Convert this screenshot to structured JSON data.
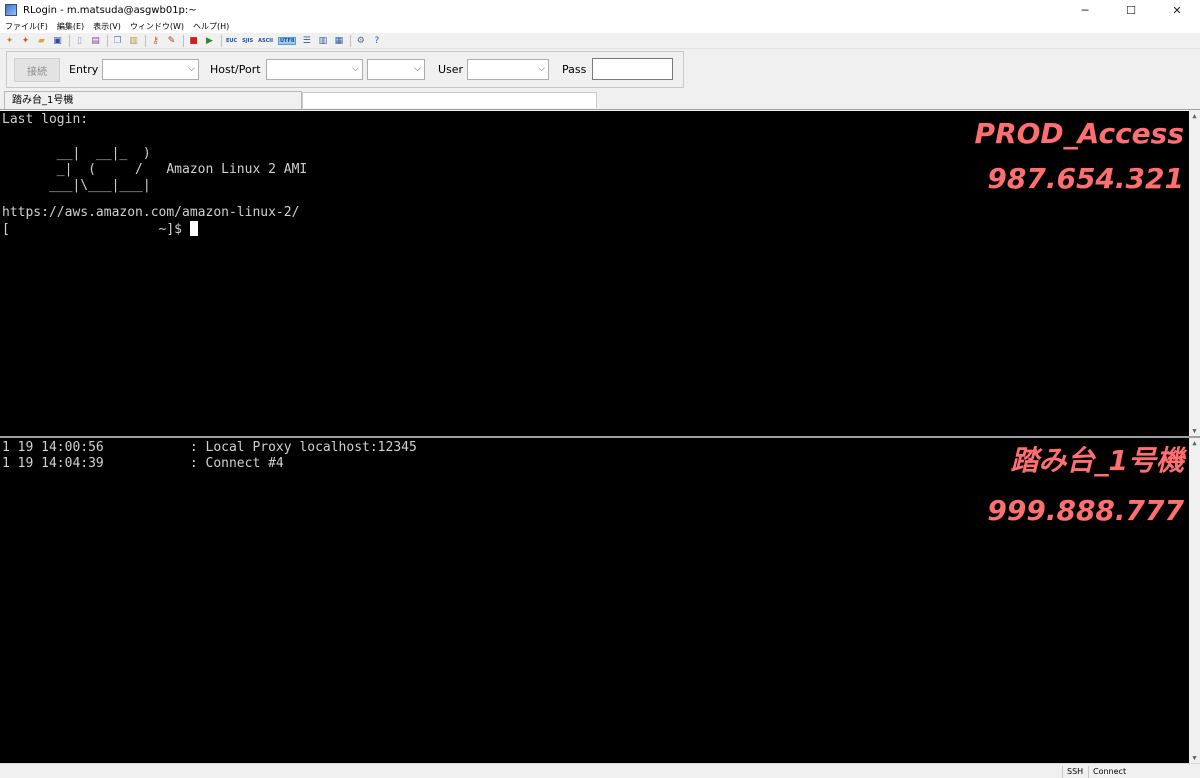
{
  "window": {
    "title": "RLogin - m.matsuda@asgwb01p:~",
    "minimize": "─",
    "maximize": "☐",
    "close": "✕"
  },
  "menu": [
    "ファイル(F)",
    "編集(E)",
    "表示(V)",
    "ウィンドウ(W)",
    "ヘルプ(H)"
  ],
  "toolbar": {
    "icons": [
      "new-connection-icon",
      "connect-icon",
      "open-icon",
      "save-icon",
      "document-icon",
      "print-icon",
      "copy-icon",
      "paste-icon",
      "key-icon",
      "tools-icon",
      "stop-icon",
      "play-icon"
    ],
    "encodings": [
      "EUC",
      "SJIS",
      "ASCII",
      "UTF8"
    ],
    "active_encoding": "UTF8"
  },
  "connect_bar": {
    "connect_label": "接続",
    "entry_label": "Entry",
    "hostport_label": "Host/Port",
    "user_label": "User",
    "pass_label": "Pass"
  },
  "tab": {
    "label": "踏み台_1号機"
  },
  "top_pane": {
    "lines": [
      "Last login:",
      "",
      "       __|  __|_  )",
      "       _|  (     /   Amazon Linux 2 AMI",
      "      ___|\\___|___|",
      "",
      "https://aws.amazon.com/amazon-linux-2/",
      "[                   ~]$ "
    ],
    "overlay_name": "PROD_Access",
    "overlay_number": "987.654.321"
  },
  "bottom_pane": {
    "lines": [
      "1 19 14:00:56           : Local Proxy localhost:12345",
      "1 19 14:04:39           : Connect #4"
    ],
    "overlay_name": "踏み台_1号機",
    "overlay_number": "999.888.777"
  },
  "status": {
    "protocol": "SSH",
    "state": "Connect"
  },
  "colors": {
    "overlay": "#ff6f6f",
    "terminal_bg": "#000000",
    "terminal_fg": "#d0d0d0"
  }
}
